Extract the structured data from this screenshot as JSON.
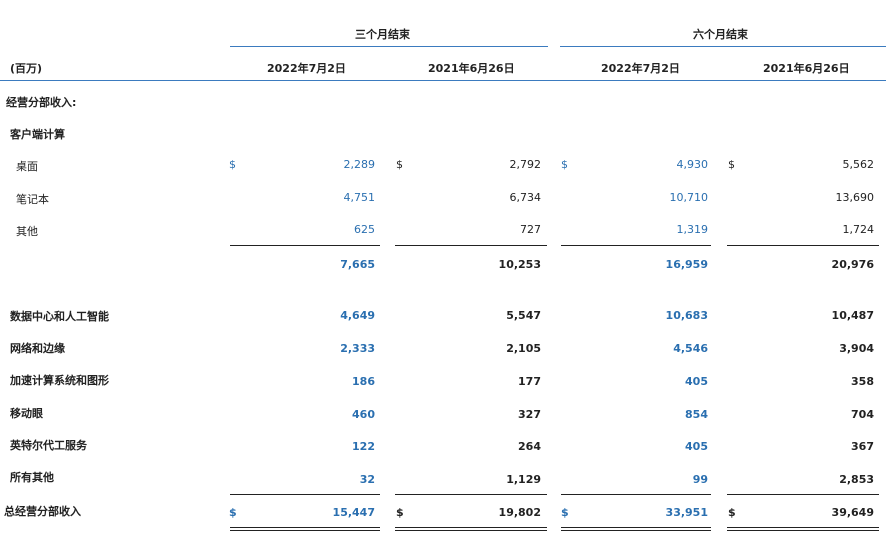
{
  "header": {
    "group1": "三个月结束",
    "group2": "六个月结束",
    "unit": "(百万)",
    "col1": "2022年7月2日",
    "col2": "2021年6月26日",
    "col3": "2022年7月2日",
    "col4": "2021年6月26日"
  },
  "rows": {
    "section": "经营分部收入:",
    "subsection": "客户端计算",
    "desktop": {
      "label": "桌面",
      "c1": "2,289",
      "c2": "2,792",
      "c3": "4,930",
      "c4": "5,562"
    },
    "notebook": {
      "label": "笔记本",
      "c1": "4,751",
      "c2": "6,734",
      "c3": "10,710",
      "c4": "13,690"
    },
    "other": {
      "label": "其他",
      "c1": "625",
      "c2": "727",
      "c3": "1,319",
      "c4": "1,724"
    },
    "ccg_total": {
      "c1": "7,665",
      "c2": "10,253",
      "c3": "16,959",
      "c4": "20,976"
    },
    "dcai": {
      "label": "数据中心和人工智能",
      "c1": "4,649",
      "c2": "5,547",
      "c3": "10,683",
      "c4": "10,487"
    },
    "nex": {
      "label": "网络和边缘",
      "c1": "2,333",
      "c2": "2,105",
      "c3": "4,546",
      "c4": "3,904"
    },
    "axg": {
      "label": "加速计算系统和图形",
      "c1": "186",
      "c2": "177",
      "c3": "405",
      "c4": "358"
    },
    "mobileye": {
      "label": "移动眼",
      "c1": "460",
      "c2": "327",
      "c3": "854",
      "c4": "704"
    },
    "ifs": {
      "label": "英特尔代工服务",
      "c1": "122",
      "c2": "264",
      "c3": "405",
      "c4": "367"
    },
    "allother": {
      "label": "所有其他",
      "c1": "32",
      "c2": "1,129",
      "c3": "99",
      "c4": "2,853"
    },
    "total": {
      "label": "总经营分部收入",
      "c1": "15,447",
      "c2": "19,802",
      "c3": "33,951",
      "c4": "39,649"
    }
  },
  "currency_symbol": "$",
  "colors": {
    "accent": "#2a6fb0",
    "text": "#222222"
  }
}
